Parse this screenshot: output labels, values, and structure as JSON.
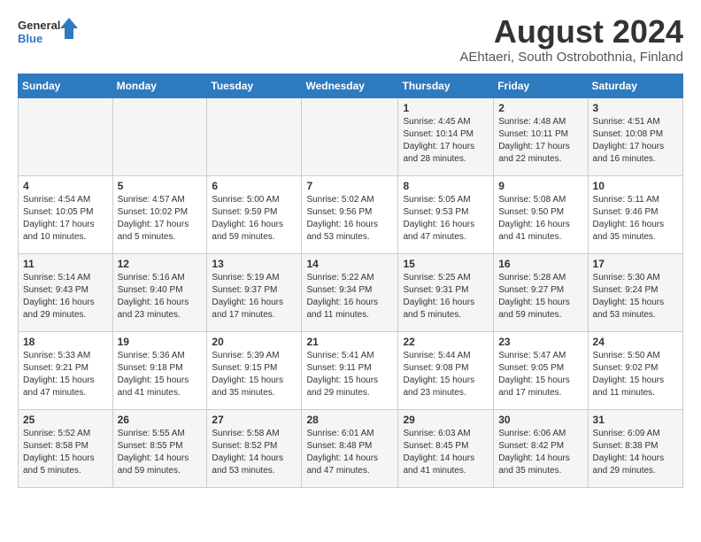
{
  "header": {
    "logo_line1": "General",
    "logo_line2": "Blue",
    "month_year": "August 2024",
    "location": "AEhtaeri, South Ostrobothnia, Finland"
  },
  "weekdays": [
    "Sunday",
    "Monday",
    "Tuesday",
    "Wednesday",
    "Thursday",
    "Friday",
    "Saturday"
  ],
  "weeks": [
    [
      {
        "day": "",
        "info": ""
      },
      {
        "day": "",
        "info": ""
      },
      {
        "day": "",
        "info": ""
      },
      {
        "day": "",
        "info": ""
      },
      {
        "day": "1",
        "info": "Sunrise: 4:45 AM\nSunset: 10:14 PM\nDaylight: 17 hours\nand 28 minutes."
      },
      {
        "day": "2",
        "info": "Sunrise: 4:48 AM\nSunset: 10:11 PM\nDaylight: 17 hours\nand 22 minutes."
      },
      {
        "day": "3",
        "info": "Sunrise: 4:51 AM\nSunset: 10:08 PM\nDaylight: 17 hours\nand 16 minutes."
      }
    ],
    [
      {
        "day": "4",
        "info": "Sunrise: 4:54 AM\nSunset: 10:05 PM\nDaylight: 17 hours\nand 10 minutes."
      },
      {
        "day": "5",
        "info": "Sunrise: 4:57 AM\nSunset: 10:02 PM\nDaylight: 17 hours\nand 5 minutes."
      },
      {
        "day": "6",
        "info": "Sunrise: 5:00 AM\nSunset: 9:59 PM\nDaylight: 16 hours\nand 59 minutes."
      },
      {
        "day": "7",
        "info": "Sunrise: 5:02 AM\nSunset: 9:56 PM\nDaylight: 16 hours\nand 53 minutes."
      },
      {
        "day": "8",
        "info": "Sunrise: 5:05 AM\nSunset: 9:53 PM\nDaylight: 16 hours\nand 47 minutes."
      },
      {
        "day": "9",
        "info": "Sunrise: 5:08 AM\nSunset: 9:50 PM\nDaylight: 16 hours\nand 41 minutes."
      },
      {
        "day": "10",
        "info": "Sunrise: 5:11 AM\nSunset: 9:46 PM\nDaylight: 16 hours\nand 35 minutes."
      }
    ],
    [
      {
        "day": "11",
        "info": "Sunrise: 5:14 AM\nSunset: 9:43 PM\nDaylight: 16 hours\nand 29 minutes."
      },
      {
        "day": "12",
        "info": "Sunrise: 5:16 AM\nSunset: 9:40 PM\nDaylight: 16 hours\nand 23 minutes."
      },
      {
        "day": "13",
        "info": "Sunrise: 5:19 AM\nSunset: 9:37 PM\nDaylight: 16 hours\nand 17 minutes."
      },
      {
        "day": "14",
        "info": "Sunrise: 5:22 AM\nSunset: 9:34 PM\nDaylight: 16 hours\nand 11 minutes."
      },
      {
        "day": "15",
        "info": "Sunrise: 5:25 AM\nSunset: 9:31 PM\nDaylight: 16 hours\nand 5 minutes."
      },
      {
        "day": "16",
        "info": "Sunrise: 5:28 AM\nSunset: 9:27 PM\nDaylight: 15 hours\nand 59 minutes."
      },
      {
        "day": "17",
        "info": "Sunrise: 5:30 AM\nSunset: 9:24 PM\nDaylight: 15 hours\nand 53 minutes."
      }
    ],
    [
      {
        "day": "18",
        "info": "Sunrise: 5:33 AM\nSunset: 9:21 PM\nDaylight: 15 hours\nand 47 minutes."
      },
      {
        "day": "19",
        "info": "Sunrise: 5:36 AM\nSunset: 9:18 PM\nDaylight: 15 hours\nand 41 minutes."
      },
      {
        "day": "20",
        "info": "Sunrise: 5:39 AM\nSunset: 9:15 PM\nDaylight: 15 hours\nand 35 minutes."
      },
      {
        "day": "21",
        "info": "Sunrise: 5:41 AM\nSunset: 9:11 PM\nDaylight: 15 hours\nand 29 minutes."
      },
      {
        "day": "22",
        "info": "Sunrise: 5:44 AM\nSunset: 9:08 PM\nDaylight: 15 hours\nand 23 minutes."
      },
      {
        "day": "23",
        "info": "Sunrise: 5:47 AM\nSunset: 9:05 PM\nDaylight: 15 hours\nand 17 minutes."
      },
      {
        "day": "24",
        "info": "Sunrise: 5:50 AM\nSunset: 9:02 PM\nDaylight: 15 hours\nand 11 minutes."
      }
    ],
    [
      {
        "day": "25",
        "info": "Sunrise: 5:52 AM\nSunset: 8:58 PM\nDaylight: 15 hours\nand 5 minutes."
      },
      {
        "day": "26",
        "info": "Sunrise: 5:55 AM\nSunset: 8:55 PM\nDaylight: 14 hours\nand 59 minutes."
      },
      {
        "day": "27",
        "info": "Sunrise: 5:58 AM\nSunset: 8:52 PM\nDaylight: 14 hours\nand 53 minutes."
      },
      {
        "day": "28",
        "info": "Sunrise: 6:01 AM\nSunset: 8:48 PM\nDaylight: 14 hours\nand 47 minutes."
      },
      {
        "day": "29",
        "info": "Sunrise: 6:03 AM\nSunset: 8:45 PM\nDaylight: 14 hours\nand 41 minutes."
      },
      {
        "day": "30",
        "info": "Sunrise: 6:06 AM\nSunset: 8:42 PM\nDaylight: 14 hours\nand 35 minutes."
      },
      {
        "day": "31",
        "info": "Sunrise: 6:09 AM\nSunset: 8:38 PM\nDaylight: 14 hours\nand 29 minutes."
      }
    ]
  ]
}
